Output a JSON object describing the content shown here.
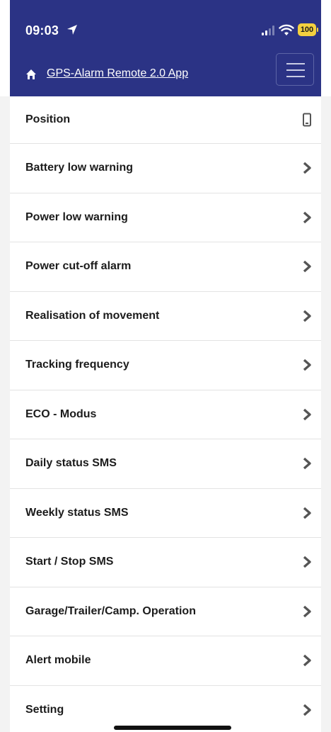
{
  "status_bar": {
    "time": "09:03",
    "battery": "100"
  },
  "navbar": {
    "app_title": "GPS-Alarm Remote 2.0 App"
  },
  "menu_items": [
    {
      "label": "Position",
      "icon": "phone-icon"
    },
    {
      "label": "Battery low warning",
      "icon": "chevron-right-icon"
    },
    {
      "label": "Power low warning",
      "icon": "chevron-right-icon"
    },
    {
      "label": "Power cut-off alarm",
      "icon": "chevron-right-icon"
    },
    {
      "label": "Realisation of movement",
      "icon": "chevron-right-icon"
    },
    {
      "label": "Tracking frequency",
      "icon": "chevron-right-icon"
    },
    {
      "label": "ECO - Modus",
      "icon": "chevron-right-icon"
    },
    {
      "label": "Daily status SMS",
      "icon": "chevron-right-icon"
    },
    {
      "label": "Weekly status SMS",
      "icon": "chevron-right-icon"
    },
    {
      "label": "Start / Stop SMS",
      "icon": "chevron-right-icon"
    },
    {
      "label": "Garage/Trailer/Camp. Operation",
      "icon": "chevron-right-icon"
    },
    {
      "label": "Alert mobile",
      "icon": "chevron-right-icon"
    },
    {
      "label": "Setting",
      "icon": "chevron-right-icon"
    }
  ],
  "colors": {
    "header_bg": "#2b3385",
    "battery": "#f4d03f",
    "icon_gray": "#555555"
  }
}
